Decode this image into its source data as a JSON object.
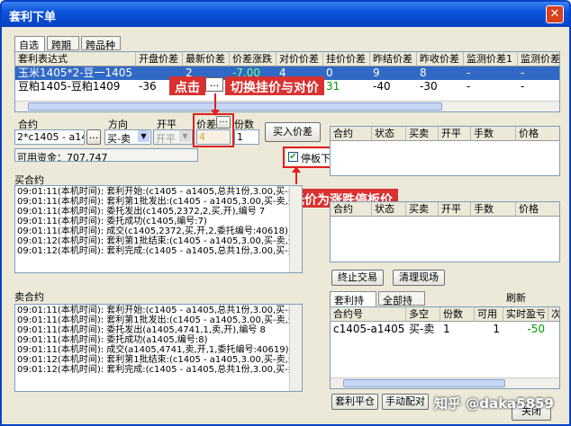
{
  "window": {
    "title": "套利下单",
    "close": "✕"
  },
  "tabs": [
    "自选",
    "跨期",
    "跨品种"
  ],
  "main_grid": {
    "headers": [
      "套利表达式",
      "开盘价差",
      "最新价差",
      "价差涨跌",
      "对价价差",
      "挂价价差",
      "昨结价差",
      "昨收价差",
      "监测价差1",
      "监测价差"
    ],
    "rows": [
      {
        "expr": "玉米1405*2-豆一1405",
        "open": "",
        "latest": "2",
        "change": "-7.00",
        "opp": "4",
        "hang": "0",
        "pre_settle": "9",
        "pre_close": "8",
        "m1": "-",
        "m2": "-"
      },
      {
        "expr": "豆粕1405-豆粕1409",
        "open": "-36",
        "latest": "",
        "change": "",
        "opp": "",
        "hang": "31",
        "pre_settle": "-40",
        "pre_close": "-30",
        "m1": "-",
        "m2": "-"
      }
    ]
  },
  "form": {
    "contract_label": "合约",
    "direction_label": "方向",
    "openclose_label": "开平",
    "spread_label": "价差",
    "qty_label": "份数",
    "contract_value": "2*c1405 - a1405",
    "ellipsis": "...",
    "direction_value": "买-卖",
    "openclose_value": "开平",
    "spread_value": "4",
    "qty_value": "1",
    "buy_button": "买入价差",
    "funds_label": "可用资金：707,747",
    "limit_checkbox": "停板下单"
  },
  "buy_contract": {
    "title": "买合约",
    "logs": [
      "09:01:11(本机时间): 套利开始:(c1405 - a1405,总共1份,3.00,买-卖,开)",
      "09:01:11(本机时间): 套利第1批发出:(c1405 - a1405,3.00,买-卖,开)",
      "09:01:11(本机时间): 委托发出(c1405,2372,2,买,开),编号 7",
      "09:01:11(本机时间): 委托成功(c1405,编号:7)",
      "09:01:11(本机时间): 成交(c1405,2372,买,开,2,委托编号:40618)",
      "09:01:12(本机时间): 套利第1批结束:(c1405 - a1405,3.00,买-卖,开)",
      "09:01:12(本机时间): 套利完成:(c1405 - a1405,总共1份,3.00,买-卖,开)"
    ]
  },
  "sell_contract": {
    "title": "卖合约",
    "logs": [
      "09:01:11(本机时间): 套利开始:(c1405 - a1405,总共1份,3.00,买-卖,开)",
      "09:01:11(本机时间): 套利第1批发出:(c1405 - a1405,3.00,买-卖,开)",
      "09:01:11(本机时间): 委托发出(a1405,4741,1,卖,开),编号 8",
      "09:01:11(本机时间): 委托成功(a1405,编号:8)",
      "09:01:11(本机时间): 成交(a1405,4741,卖,开,1,委托编号:40619)",
      "09:01:12(本机时间): 套利第1批结束:(c1405 - a1405,3.00,买-卖,开)",
      "09:01:12(本机时间): 套利完成:(c1405 - a1405,总共1份,3.00,买-卖,开)"
    ]
  },
  "order_grid": {
    "headers": [
      "合约",
      "状态",
      "买卖",
      "开平",
      "手数",
      "价格"
    ]
  },
  "fill_grid": {
    "headers": [
      "合约",
      "状态",
      "买卖",
      "开平",
      "手数",
      "价格"
    ]
  },
  "buttons": {
    "stop": "终止交易",
    "clear": "清理现场",
    "close_arb": "套利平仓",
    "manual": "手动配对",
    "close": "关闭"
  },
  "positions": {
    "tabs": [
      "套利持仓",
      "全部持仓"
    ],
    "refresh": "刷新",
    "headers": [
      "合约号",
      "多空",
      "份数",
      "可用",
      "实时盈亏",
      "次"
    ],
    "row": {
      "contract": "c1405-a1405",
      "side": "买-卖",
      "qty": "1",
      "avail": "1",
      "pnl": "-50"
    }
  },
  "annotations": {
    "click_tip": "点击",
    "click_btn": "...",
    "switch_tip": "切换挂价与对价",
    "check_tip": "勾选，委托价为涨跌停板价"
  },
  "watermark": "知乎 @daka5859",
  "colors": {
    "title_bar": "#0842c3",
    "callout": "#d93030",
    "selected_row": "#316ac5",
    "positive": "#00a000",
    "negative": "#00a000"
  }
}
